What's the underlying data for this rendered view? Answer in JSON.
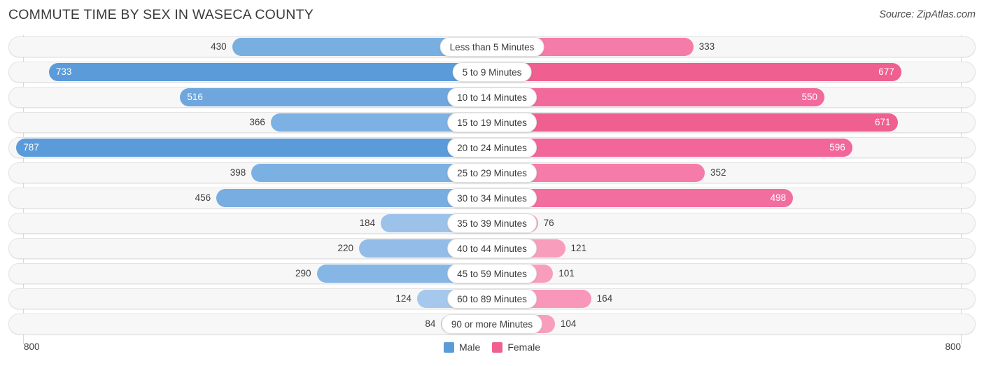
{
  "header": {
    "title": "COMMUTE TIME BY SEX IN WASECA COUNTY",
    "source": "Source: ZipAtlas.com"
  },
  "axis": {
    "left_end_label": "800",
    "right_end_label": "800"
  },
  "legend": {
    "items": [
      {
        "label": "Male",
        "color": "#5b9bd9"
      },
      {
        "label": "Female",
        "color": "#ef5f90"
      }
    ]
  },
  "chart_data": {
    "type": "bar",
    "title": "COMMUTE TIME BY SEX IN WASECA COUNTY",
    "subtitle": "Source: ZipAtlas.com",
    "orientation": "horizontal-diverging",
    "xlabel": "",
    "ylabel": "",
    "axis_max": 800,
    "xlim": [
      800,
      800
    ],
    "grid": true,
    "legend_position": "bottom-center",
    "categories": [
      "Less than 5 Minutes",
      "5 to 9 Minutes",
      "10 to 14 Minutes",
      "15 to 19 Minutes",
      "20 to 24 Minutes",
      "25 to 29 Minutes",
      "30 to 34 Minutes",
      "35 to 39 Minutes",
      "40 to 44 Minutes",
      "45 to 59 Minutes",
      "60 to 89 Minutes",
      "90 or more Minutes"
    ],
    "series": [
      {
        "name": "Male",
        "side": "left",
        "color": "#5b9bd9",
        "values": [
          430,
          733,
          516,
          366,
          787,
          398,
          456,
          184,
          220,
          290,
          124,
          84
        ]
      },
      {
        "name": "Female",
        "side": "right",
        "color": "#ef5f90",
        "values": [
          333,
          677,
          550,
          671,
          596,
          352,
          498,
          76,
          121,
          101,
          164,
          104
        ]
      }
    ],
    "rows": [
      {
        "label": "Less than 5 Minutes",
        "male": 430,
        "female": 333,
        "male_color": "#79aee1",
        "female_color": "#f57ba8",
        "male_label_inside": false,
        "female_label_inside": false
      },
      {
        "label": "5 to 9 Minutes",
        "male": 733,
        "female": 677,
        "male_color": "#5b9bd9",
        "female_color": "#ef5f90",
        "male_label_inside": true,
        "female_label_inside": true
      },
      {
        "label": "10 to 14 Minutes",
        "male": 516,
        "female": 550,
        "male_color": "#6ea6dd",
        "female_color": "#f2699b",
        "male_label_inside": true,
        "female_label_inside": true
      },
      {
        "label": "15 to 19 Minutes",
        "male": 366,
        "female": 671,
        "male_color": "#7db1e3",
        "female_color": "#ef5f90",
        "male_label_inside": false,
        "female_label_inside": true
      },
      {
        "label": "20 to 24 Minutes",
        "male": 787,
        "female": 596,
        "male_color": "#5b9bd9",
        "female_color": "#f2669a",
        "male_label_inside": true,
        "female_label_inside": true
      },
      {
        "label": "25 to 29 Minutes",
        "male": 398,
        "female": 352,
        "male_color": "#7bb0e2",
        "female_color": "#f57ba8",
        "male_label_inside": false,
        "female_label_inside": false
      },
      {
        "label": "30 to 34 Minutes",
        "male": 456,
        "female": 498,
        "male_color": "#77ade1",
        "female_color": "#f26e9f",
        "male_label_inside": false,
        "female_label_inside": true
      },
      {
        "label": "35 to 39 Minutes",
        "male": 184,
        "female": 76,
        "male_color": "#9cc2ea",
        "female_color": "#f9a0bf",
        "male_label_inside": false,
        "female_label_inside": false
      },
      {
        "label": "40 to 44 Minutes",
        "male": 220,
        "female": 121,
        "male_color": "#93bde8",
        "female_color": "#f99dbd",
        "male_label_inside": false,
        "female_label_inside": false
      },
      {
        "label": "45 to 59 Minutes",
        "male": 290,
        "female": 101,
        "male_color": "#86b6e5",
        "female_color": "#f99dbd",
        "male_label_inside": false,
        "female_label_inside": false
      },
      {
        "label": "60 to 89 Minutes",
        "male": 124,
        "female": 164,
        "male_color": "#a5c8ec",
        "female_color": "#f897ba",
        "male_label_inside": false,
        "female_label_inside": false
      },
      {
        "label": "90 or more Minutes",
        "male": 84,
        "female": 104,
        "male_color": "#a8c8ea",
        "female_color": "#f99dbd",
        "male_label_inside": false,
        "female_label_inside": false
      }
    ]
  }
}
